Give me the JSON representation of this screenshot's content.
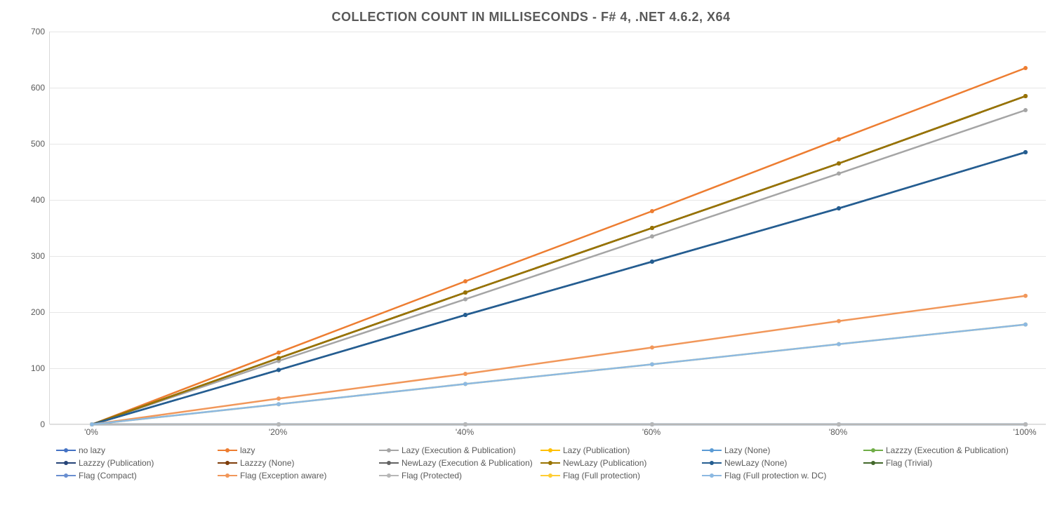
{
  "chart_data": {
    "type": "line",
    "title": "COLLECTION COUNT IN MILLISECONDS - F# 4, .NET 4.6.2, X64",
    "xlabel": "",
    "ylabel": "",
    "ylim": [
      0,
      700
    ],
    "yticks": [
      0,
      100,
      200,
      300,
      400,
      500,
      600,
      700
    ],
    "categories": [
      "'0%",
      "'20%",
      "'40%",
      "'60%",
      "'80%",
      "'100%"
    ],
    "series": [
      {
        "name": "no lazy",
        "color": "#4472C4",
        "values": [
          0,
          0,
          0,
          0,
          0,
          0
        ]
      },
      {
        "name": "lazy",
        "color": "#ED7D31",
        "values": [
          0,
          128,
          255,
          380,
          508,
          635
        ]
      },
      {
        "name": "Lazy (Execution & Publication)",
        "color": "#A5A5A5",
        "values": [
          0,
          113,
          223,
          335,
          447,
          560
        ]
      },
      {
        "name": "Lazy (Publication)",
        "color": "#FFC000",
        "values": [
          0,
          118,
          235,
          350,
          465,
          585
        ]
      },
      {
        "name": "Lazy (None)",
        "color": "#5B9BD5",
        "values": [
          0,
          97,
          195,
          290,
          385,
          485
        ]
      },
      {
        "name": "Lazzzy (Execution & Publication)",
        "color": "#70AD47",
        "values": [
          0,
          118,
          235,
          350,
          465,
          585
        ]
      },
      {
        "name": "Lazzzy (Publication)",
        "color": "#264478",
        "values": [
          0,
          97,
          195,
          290,
          385,
          485
        ]
      },
      {
        "name": "Lazzzy (None)",
        "color": "#7F3E0B",
        "values": [
          0,
          118,
          235,
          350,
          465,
          585
        ]
      },
      {
        "name": "NewLazy (Execution & Publication)",
        "color": "#636363",
        "values": [
          0,
          118,
          235,
          350,
          465,
          585
        ]
      },
      {
        "name": "NewLazy (Publication)",
        "color": "#997300",
        "values": [
          0,
          118,
          235,
          350,
          465,
          585
        ]
      },
      {
        "name": "NewLazy (None)",
        "color": "#255E91",
        "values": [
          0,
          97,
          195,
          290,
          385,
          485
        ]
      },
      {
        "name": "Flag (Trivial)",
        "color": "#43682B",
        "values": [
          0,
          0,
          0,
          0,
          0,
          0
        ]
      },
      {
        "name": "Flag (Compact)",
        "color": "#698ED0",
        "values": [
          0,
          0,
          0,
          0,
          0,
          0
        ]
      },
      {
        "name": "Flag (Exception aware)",
        "color": "#F1975A",
        "values": [
          0,
          46,
          90,
          137,
          184,
          229
        ]
      },
      {
        "name": "Flag (Protected)",
        "color": "#B7B7B7",
        "values": [
          0,
          0,
          0,
          0,
          0,
          0
        ]
      },
      {
        "name": "Flag (Full protection)",
        "color": "#FFCD33",
        "values": [
          0,
          36,
          72,
          107,
          143,
          178
        ]
      },
      {
        "name": "Flag (Full protection w. DC)",
        "color": "#8CB9E2",
        "values": [
          0,
          36,
          72,
          107,
          143,
          178
        ]
      }
    ]
  }
}
